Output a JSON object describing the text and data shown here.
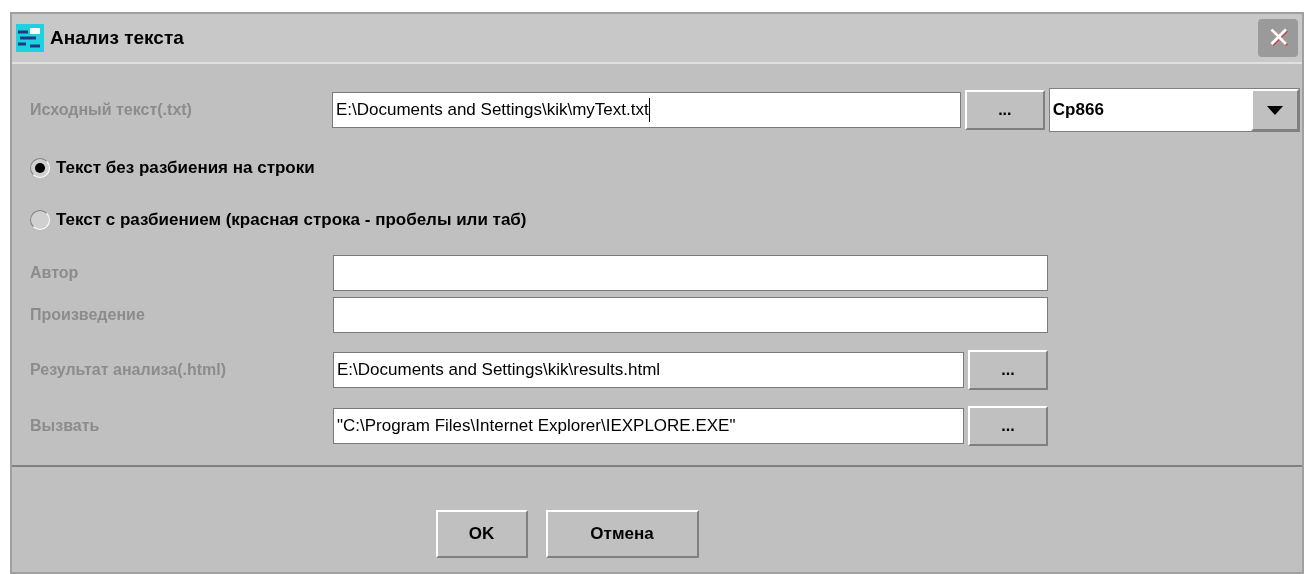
{
  "window": {
    "title": "Анализ текста",
    "close": "✕"
  },
  "source": {
    "label": "Исходный текст(.txt)",
    "value": "E:\\Documents and Settings\\kik\\myText.txt",
    "browse": "...",
    "encoding": "Cp866"
  },
  "modes": [
    {
      "label": "Текст без разбиения на строки",
      "selected": true
    },
    {
      "label": "Текст с разбиением (красная строка - пробелы или таб)",
      "selected": false
    }
  ],
  "fields": [
    {
      "kind": "plain",
      "label": "Автор"
    },
    {
      "kind": "plain",
      "label": "Произведение"
    },
    {
      "kind": "browse",
      "label": "Результат анализа(.html)",
      "value": "E:\\Documents and Settings\\kik\\results.html",
      "browse": "..."
    },
    {
      "kind": "browse",
      "label": "Вызвать",
      "value": "\"C:\\Program Files\\Internet Explorer\\IEXPLORE.EXE\"",
      "browse": "..."
    }
  ],
  "buttons": [
    "OK",
    "Отмена"
  ]
}
